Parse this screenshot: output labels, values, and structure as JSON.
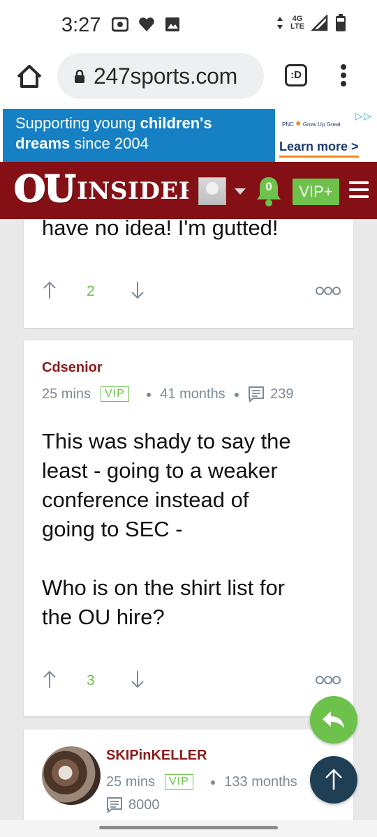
{
  "status_bar": {
    "time": "3:27",
    "network": "4G LTE",
    "icons": [
      "cast-icon",
      "heart-icon",
      "image-icon",
      "data-arrows-icon",
      "signal-icon",
      "battery-icon"
    ]
  },
  "browser": {
    "url": "247sports.com",
    "tab_label": ":D"
  },
  "ad": {
    "line1_pre": "Supporting young ",
    "line1_bold": "children's",
    "line2_bold": "dreams",
    "line2_post": " since 2004",
    "brand1": "PNC",
    "brand2": "Grow Up Great",
    "cta": "Learn more >"
  },
  "header": {
    "logo_ou": "OU",
    "logo_insider": "INSIDER",
    "notification_count": "0",
    "vip_label": "VIP+",
    "colors": {
      "background": "#840f15",
      "vip": "#6cc24a"
    }
  },
  "posts": [
    {
      "body": "have no idea! I'm gutted!",
      "votes": "2"
    },
    {
      "author": "Cdsenior",
      "time": "25 mins",
      "badge": "VIP",
      "tenure": "41 months",
      "post_count": "239",
      "body": "This was shady to say the\nleast - going to a weaker\nconference instead of\ngoing to SEC -\n\nWho is on the shirt list for\nthe OU hire?",
      "votes": "3"
    },
    {
      "author": "SKIPinKELLER",
      "time": "25 mins",
      "badge": "VIP",
      "tenure": "133 months",
      "post_count": "8000"
    }
  ],
  "colors": {
    "author": "#8b1a1a",
    "accent_green": "#6cc24a",
    "meta_gray": "#7d8a96",
    "fab_top": "#1f3f55"
  }
}
